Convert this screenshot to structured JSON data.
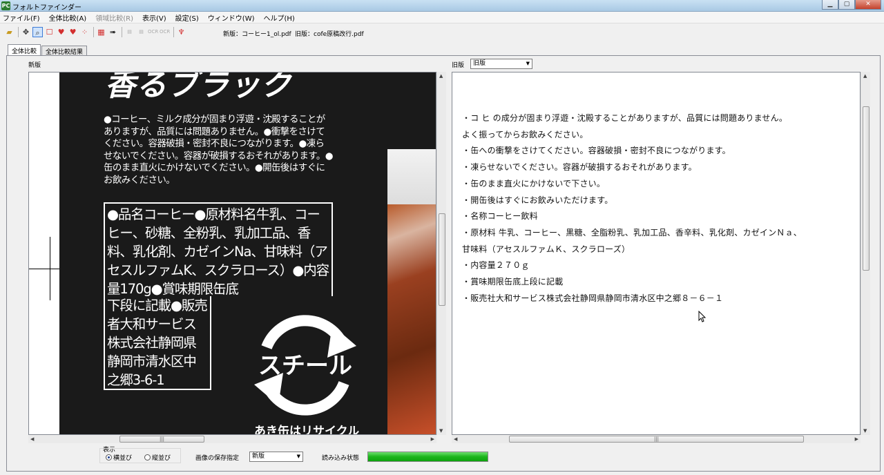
{
  "window": {
    "title": "フォルトファインダー",
    "app_icon": "PC"
  },
  "menu": [
    {
      "label": "ファイル(F)",
      "enabled": true
    },
    {
      "label": "全体比較(A)",
      "enabled": true
    },
    {
      "label": "領域比較(R)",
      "enabled": false
    },
    {
      "label": "表示(V)",
      "enabled": true
    },
    {
      "label": "設定(S)",
      "enabled": true
    },
    {
      "label": "ウィンドウ(W)",
      "enabled": true
    },
    {
      "label": "ヘルプ(H)",
      "enabled": true
    }
  ],
  "toolbar": {
    "icons": [
      "open-folder-icon",
      "move-icon",
      "zoom-icon",
      "select-rect-icon",
      "red-marker-icon",
      "red-marker2-icon",
      "red-dots-icon",
      "compare-icon",
      "export-icon",
      "ocr-gray1-icon",
      "ocr-gray2-icon",
      "ocr1-icon",
      "ocr2-icon",
      "pin-icon"
    ],
    "new_file_label": "新版：コーヒー1_ol.pdf",
    "old_file_label": "旧版：cofe原稿改行.pdf"
  },
  "tabs": [
    {
      "label": "全体比較",
      "active": true
    },
    {
      "label": "全体比較結果",
      "active": false
    }
  ],
  "left_pane": {
    "label": "新版",
    "package_heading": "香るブラック",
    "package_notice": "●コーヒー、ミルク成分が固まり浮遊・沈殿することがありますが、品質には問題ありません。●衝撃をさけてください。容器破損・密封不良につながります。●凍らせないでください。容器が破損するおそれがあります。●缶のまま直火にかけないでください。●開缶後はすぐにお飲みください。",
    "package_box_full": "●品名コーヒー●原材料名牛乳、コーヒー、砂糖、全粉乳、乳加工品、香料、乳化剤、カゼインNa、甘味料（アセスルファムK、スクラロース）●内容量170g●賞味期限缶底",
    "package_box_narrow": "下段に記載●販売者大和サービス株式会社静岡県静岡市清水区中之郷3-6-1",
    "recycle_text": "スチール",
    "recycle_label": "あき缶はリサイクル"
  },
  "right_pane": {
    "label": "旧版",
    "combo_value": "旧版",
    "ocr_lines": [
      "・コ ヒ の成分が固まり浮遊・沈殿することがありますが、品質には問題ありません。",
      "よく振ってからお飲みください。",
      "・缶への衝撃をさけてください。容器破損・密封不良につながります。",
      "・凍らせないでください。容器が破損するおそれがあります。",
      "・缶のまま直火にかけないで下さい。",
      "・開缶後はすぐにお飲みいただけます。",
      "・名称コーヒー飲料",
      "・原材料 牛乳、コーヒー、黒糖、全脂粉乳、乳加工品、香辛料、乳化剤、カゼインＮａ、",
      "甘味料（アセスルファムＫ、スクラローズ）",
      "・内容量２７０ｇ",
      "・賞味期限缶底上段に記載",
      "・販売社大和サービス株式会社静岡県静岡市清水区中之郷８－６－１"
    ]
  },
  "bottom": {
    "display_label": "表示",
    "radio_side": "横並び",
    "radio_vertical": "縦並び",
    "save_label": "画像の保存指定",
    "save_value": "新版",
    "status_label": "読み込み状態",
    "progress": 1.0
  },
  "colors": {
    "progress": "#1cb51c",
    "selected_tool": "#cfe3fb",
    "package_bg": "#1a1a1a"
  }
}
